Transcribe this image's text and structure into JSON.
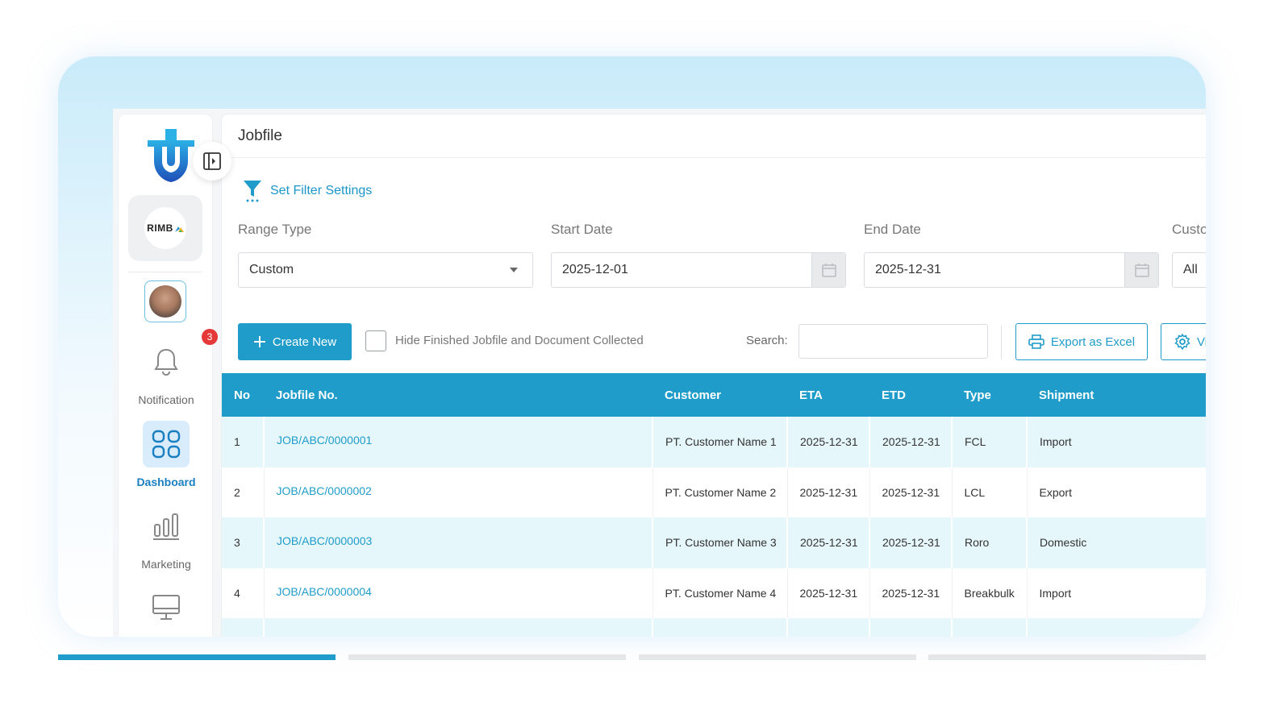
{
  "sidebar": {
    "company_logo_text": "RIMB",
    "notification_badge": "3",
    "items": [
      {
        "label": "Notification",
        "icon": "bell-icon",
        "active": false
      },
      {
        "label": "Dashboard",
        "icon": "grid-icon",
        "active": true
      },
      {
        "label": "Marketing",
        "icon": "bar-chart-icon",
        "active": false
      },
      {
        "label": "",
        "icon": "monitor-icon",
        "active": false
      }
    ]
  },
  "header": {
    "title": "Jobfile"
  },
  "filter": {
    "link_label": "Set Filter Settings",
    "range_type_label": "Range Type",
    "range_type_value": "Custom",
    "start_date_label": "Start Date",
    "start_date_value": "2025-12-01",
    "end_date_label": "End Date",
    "end_date_value": "2025-12-31",
    "customer_label": "Custo",
    "customer_value": "All"
  },
  "toolbar": {
    "create_label": "Create New",
    "hide_finished_label": "Hide Finished Jobfile and Document Collected",
    "search_label": "Search:",
    "search_value": "",
    "export_label": "Export as Excel",
    "view_label": "Vi"
  },
  "table": {
    "columns": [
      "No",
      "Jobfile No.",
      "Customer",
      "ETA",
      "ETD",
      "Type",
      "Shipment"
    ],
    "rows": [
      {
        "no": "1",
        "jobfile": "JOB/ABC/0000001",
        "customer": "PT. Customer Name 1",
        "eta": "2025-12-31",
        "etd": "2025-12-31",
        "type": "FCL",
        "shipment": "Import"
      },
      {
        "no": "2",
        "jobfile": "JOB/ABC/0000002",
        "customer": "PT. Customer Name 2",
        "eta": "2025-12-31",
        "etd": "2025-12-31",
        "type": "LCL",
        "shipment": "Export"
      },
      {
        "no": "3",
        "jobfile": "JOB/ABC/0000003",
        "customer": "PT. Customer Name 3",
        "eta": "2025-12-31",
        "etd": "2025-12-31",
        "type": "Roro",
        "shipment": "Domestic"
      },
      {
        "no": "4",
        "jobfile": "JOB/ABC/0000004",
        "customer": "PT. Customer Name 4",
        "eta": "2025-12-31",
        "etd": "2025-12-31",
        "type": "Breakbulk",
        "shipment": "Import"
      }
    ]
  },
  "colors": {
    "accent": "#1f9cc9",
    "row_alt": "#e6f7fb",
    "badge": "#e53939"
  }
}
